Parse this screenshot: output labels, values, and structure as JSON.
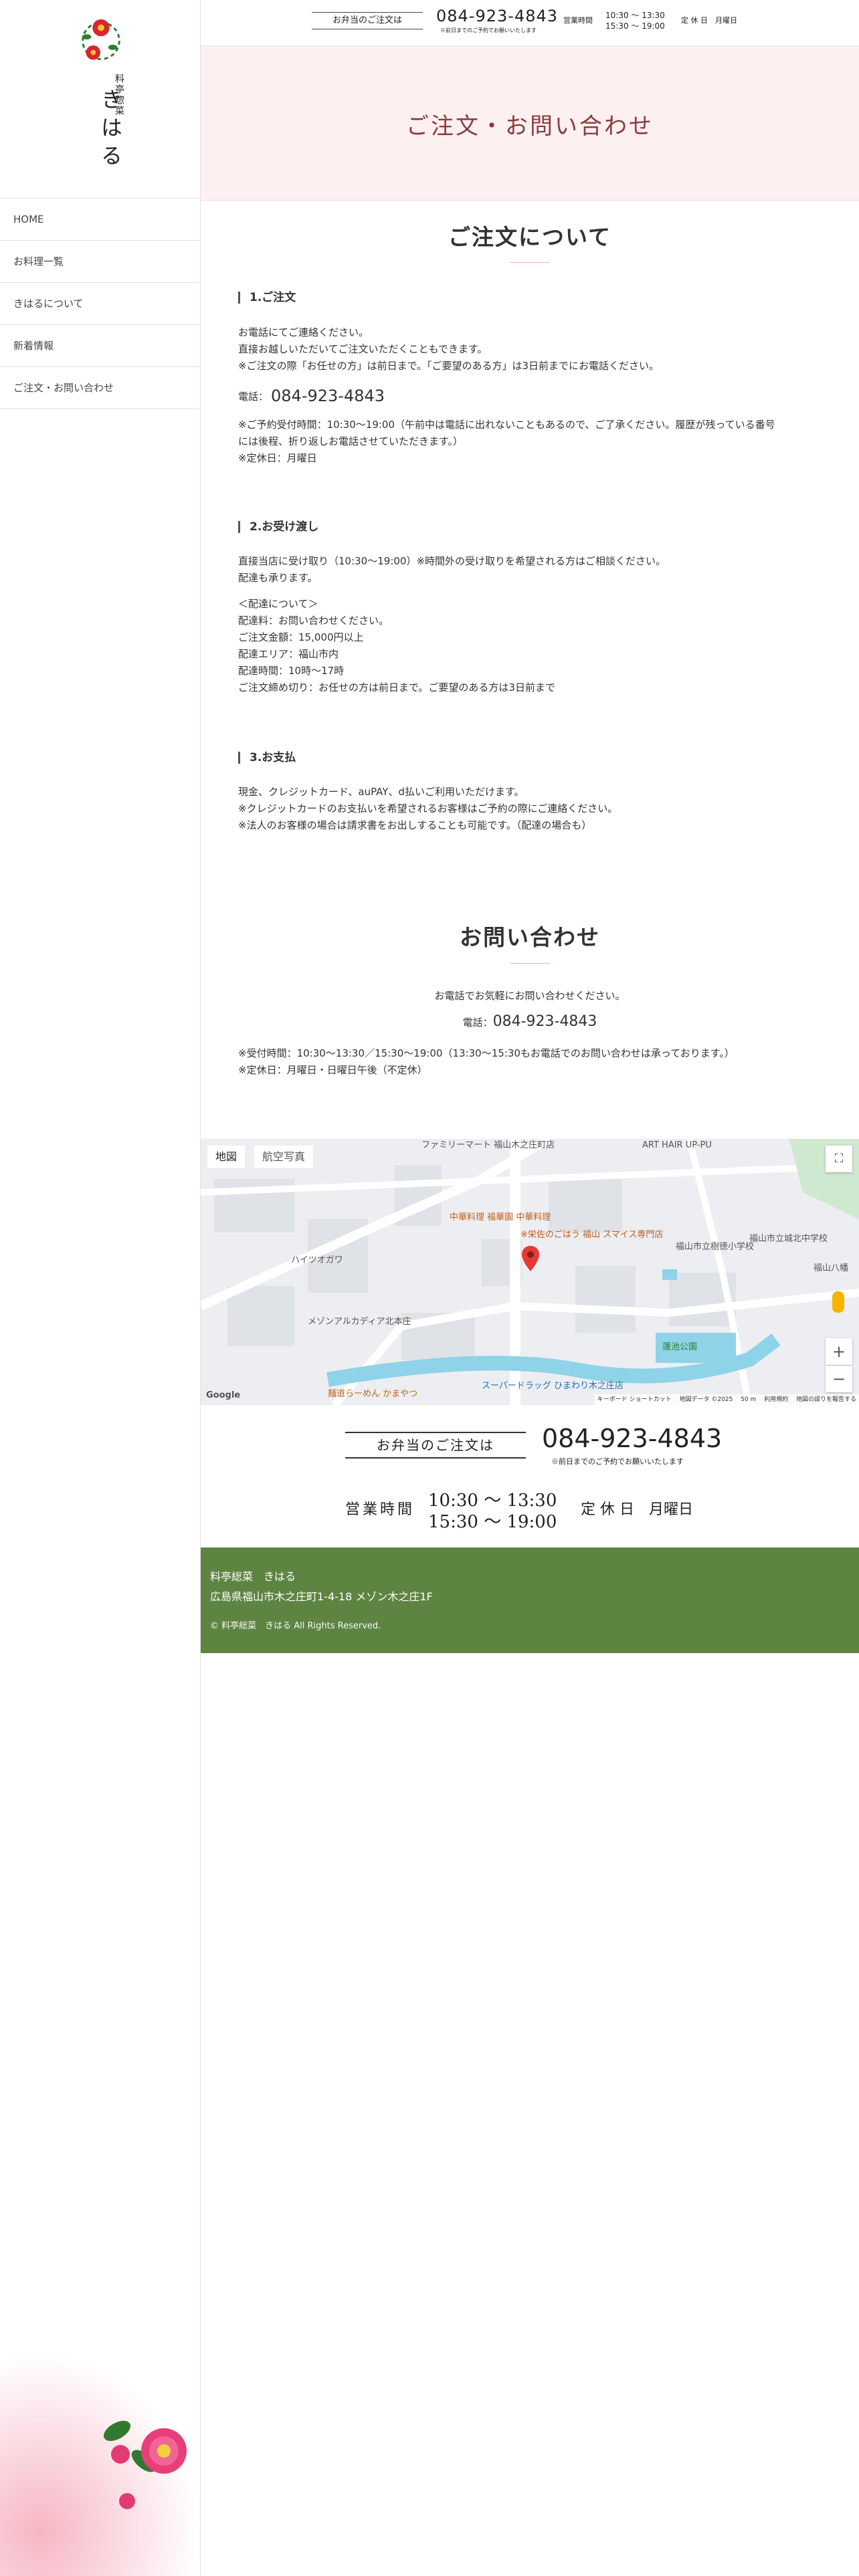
{
  "sidebar": {
    "logo": {
      "sub": "料亭惣菜",
      "name": "きはる"
    },
    "nav": [
      {
        "label": "HOME"
      },
      {
        "label": "お料理一覧"
      },
      {
        "label": "きはるについて"
      },
      {
        "label": "新着情報"
      },
      {
        "label": "ご注文・お問い合わせ"
      }
    ]
  },
  "topbar": {
    "order_label": "お弁当のご注文は",
    "phone": "084-923-4843",
    "phone_note": "※前日までのご予約でお願いいたします",
    "hours_label": "営業時間",
    "hours_1": "10:30 ～ 13:30",
    "hours_2": "15:30 ～ 19:00",
    "holiday": "定 休 日　月曜日"
  },
  "hero": {
    "title": "ご注文・お問い合わせ"
  },
  "order": {
    "title": "ご注文について",
    "s1": {
      "heading": "1.ご注文",
      "lines": [
        "お電話にてご連絡ください。",
        "直接お越しいただいてご注文いただくこともできます。",
        "※ご注文の際「お任せの方」は前日まで。「ご要望のある方」は3日前までにお電話ください。"
      ],
      "phone_label": "電話：",
      "phone": "084-923-4843",
      "notes": [
        "※ご予約受付時間：10:30～19:00（午前中は電話に出れないこともあるので、ご了承ください。履歴が残っている番号",
        "には後程、折り返しお電話させていただきます。）",
        "※定休日：月曜日"
      ]
    },
    "s2": {
      "heading": "2.お受け渡し",
      "lines": [
        "直接当店に受け取り（10:30～19:00）※時間外の受け取りを希望される方はご相談ください。",
        "配達も承ります。"
      ],
      "delivery": [
        "＜配達について＞",
        "配達料：お問い合わせください。",
        "ご注文金額：15,000円以上",
        "配達エリア：福山市内",
        "配達時間：10時～17時",
        "ご注文締め切り：お任せの方は前日まで。ご要望のある方は3日前まで"
      ]
    },
    "s3": {
      "heading": "3.お支払",
      "lines": [
        "現金、クレジットカード、auPAY、d払いご利用いただけます。",
        "※クレジットカードのお支払いを希望されるお客様はご予約の際にご連絡ください。",
        "※法人のお客様の場合は請求書をお出しすることも可能です。（配達の場合も）"
      ]
    }
  },
  "contact": {
    "title": "お問い合わせ",
    "intro": "お電話でお気軽にお問い合わせください。",
    "phone_label": "電話：",
    "phone": "084-923-4843",
    "notes": [
      "※受付時間：10:30～13:30／15:30～19:00（13:30～15:30もお電話でのお問い合わせは承っております。）",
      "※定休日：月曜日・日曜日午後（不定休）"
    ]
  },
  "map": {
    "tab_map": "地図",
    "tab_satellite": "航空写真",
    "labels": [
      "ファミリーマート 福山木之庄町店",
      "ART HAIR UP-PU",
      "福山市立城北中学校",
      "中華料理 福華園 中華料理",
      "※栄佐のごはう 福山 スマイス専門店",
      "ハイツオガワ",
      "福山市立樹徳小学校",
      "福山八幡",
      "メゾンアルカディア北本庄",
      "蓮池公園",
      "麺道らーめん かまやつ",
      "スーパードラッグ ひまわり木之庄店"
    ],
    "footer": [
      "キーボード ショートカット",
      "地図データ ©2025",
      "50 m",
      "利用規約",
      "地図の誤りを報告する"
    ],
    "google": "Google"
  },
  "banner": {
    "order_label": "お弁当のご注文は",
    "phone": "084-923-4843",
    "phone_note": "※前日までのご予約でお願いいたします",
    "hours_label": "営業時間",
    "hours_1": "10:30 ～ 13:30",
    "hours_2": "15:30 ～ 19:00",
    "holiday": "定 休 日　月曜日"
  },
  "footer": {
    "name": "料亭総菜　きはる",
    "address": "広島県福山市木之庄町1-4-18 メゾン木之庄1F",
    "copyright": "© 料亭総菜　きはる All Rights Reserved."
  },
  "colors": {
    "hero_bg": "#fdf0f1",
    "hero_text": "#8b3b3b",
    "footer_bg": "#5e8442",
    "accent_pink": "#e6b7bc"
  }
}
